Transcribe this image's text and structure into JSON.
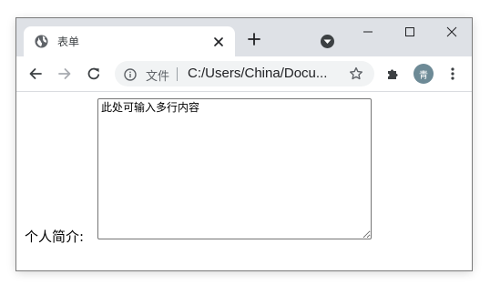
{
  "tab": {
    "title": "表单",
    "favicon_icon": "globe-icon",
    "close_icon": "close-icon"
  },
  "tabstrip": {
    "new_tab_icon": "plus-icon",
    "search_tabs_icon": "chevron-down-circle-icon"
  },
  "window_controls": [
    "minimize-icon",
    "maximize-icon",
    "close-icon"
  ],
  "toolbar": {
    "back_icon": "arrow-left-icon",
    "forward_icon": "arrow-right-icon",
    "reload_icon": "reload-icon",
    "omnibox": {
      "info_icon": "info-icon",
      "scheme_label": "文件",
      "url": "C:/Users/China/Docu...",
      "star_icon": "star-icon"
    },
    "extensions_icon": "puzzle-icon",
    "profile_initial": "青",
    "menu_icon": "more-vert-icon"
  },
  "form": {
    "label": "个人简介:",
    "textarea_placeholder": "此处可输入多行内容"
  },
  "colors": {
    "titlebar": "#dee1e6",
    "omnibox": "#f1f3f4",
    "avatar": "#6d8a96"
  }
}
